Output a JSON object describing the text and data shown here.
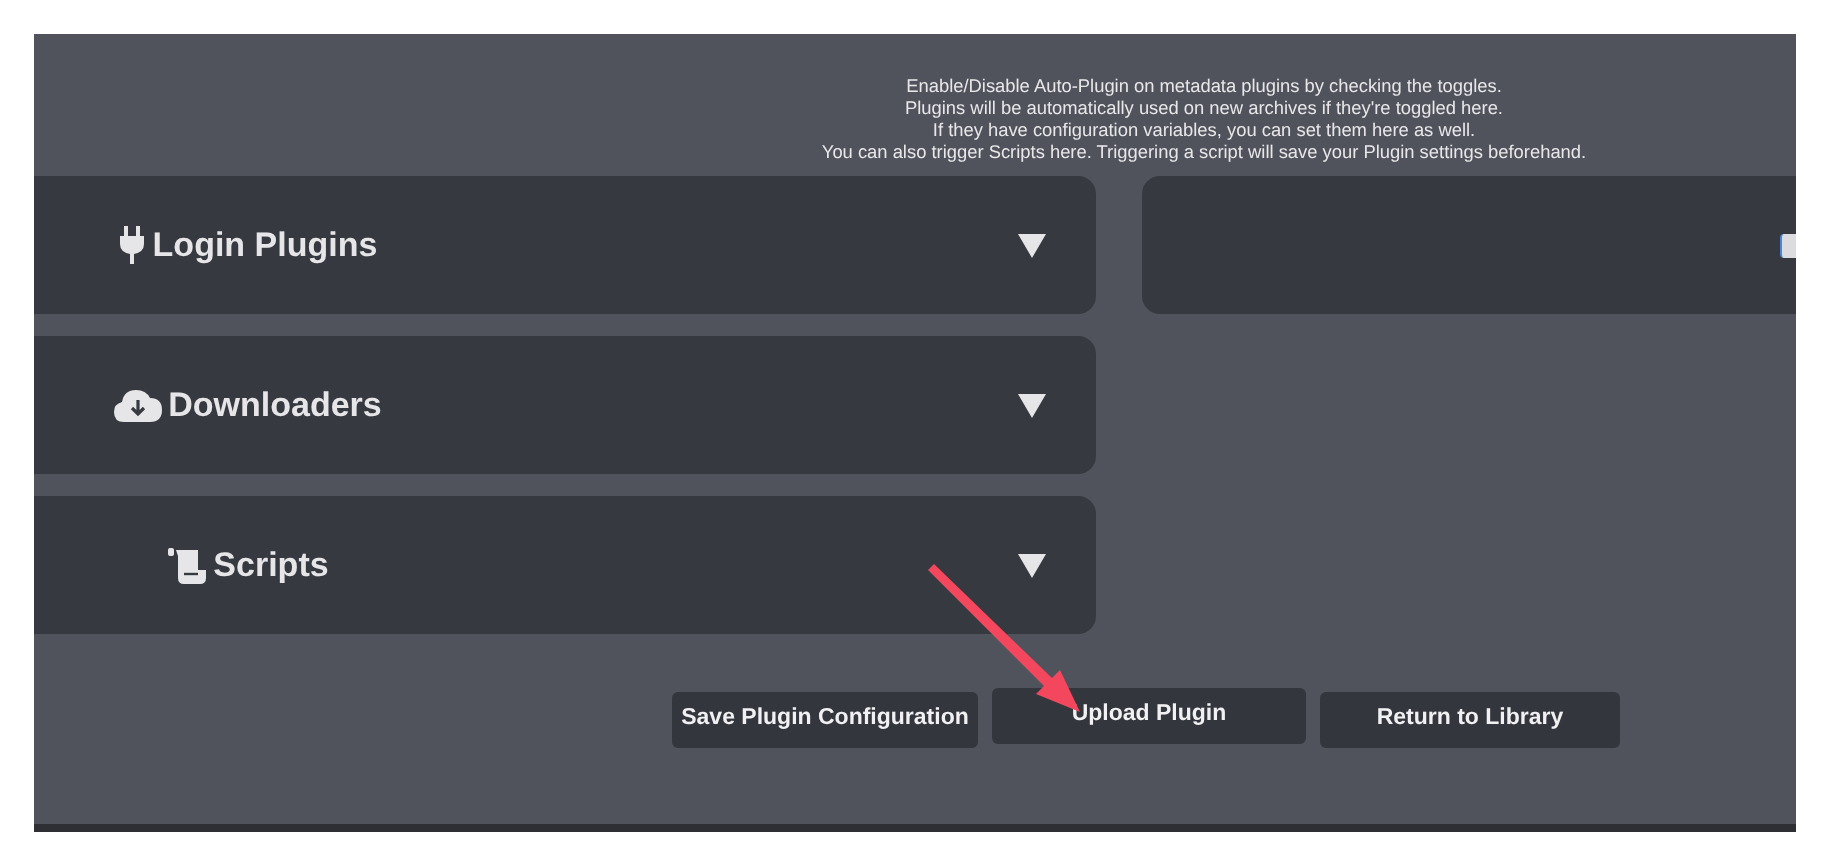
{
  "description": [
    "Enable/Disable Auto-Plugin on metadata plugins by checking the toggles.",
    "Plugins will be automatically used on new archives if they're toggled here.",
    "If they have configuration variables, you can set them here as well.",
    "You can also trigger Scripts here. Triggering a script will save your Plugin settings beforehand."
  ],
  "sections": [
    {
      "title": "Login Plugins",
      "expanded": false
    },
    {
      "title": "Downloaders",
      "expanded": false
    },
    {
      "title": "Scripts",
      "expanded": false
    }
  ],
  "buttons": [
    "Save Plugin Configuration",
    "Upload Plugin",
    "Return to Library"
  ]
}
